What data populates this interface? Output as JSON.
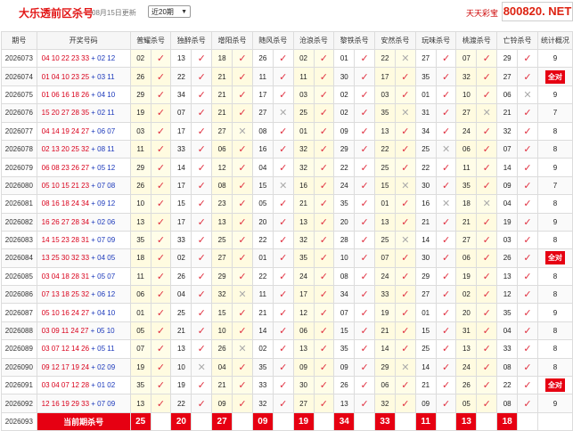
{
  "header": {
    "title": "大乐透前区杀号",
    "updated": "08月15日更新",
    "select_value": "近20期",
    "brand": "天天彩宝",
    "watermark": "800820. NET"
  },
  "columns": [
    "期号",
    "开奖号码",
    "普耀杀号",
    "独醉杀号",
    "增阳杀号",
    "随风杀号",
    "沧浪杀号",
    "黎铁杀号",
    "安然杀号",
    "玩味杀号",
    "桃渡杀号",
    "亡铃杀号",
    "统计概况"
  ],
  "rows": [
    {
      "p": "2026073",
      "f": "04 10 22 23 33",
      "b": "02 12",
      "v": [
        "02",
        "13",
        "18",
        "26",
        "02",
        "01",
        "22",
        "27",
        "07",
        "29"
      ],
      "m": [
        1,
        1,
        1,
        1,
        1,
        1,
        0,
        1,
        1,
        1
      ],
      "s": "9"
    },
    {
      "p": "2026074",
      "f": "01 04 10 23 25",
      "b": "03 11",
      "v": [
        "26",
        "22",
        "21",
        "11",
        "11",
        "30",
        "17",
        "35",
        "32",
        "27"
      ],
      "m": [
        1,
        1,
        1,
        1,
        1,
        1,
        1,
        1,
        1,
        1
      ],
      "s": "全对"
    },
    {
      "p": "2026075",
      "f": "01 06 16 18 26",
      "b": "04 10",
      "v": [
        "29",
        "34",
        "21",
        "17",
        "03",
        "02",
        "03",
        "01",
        "10",
        "06"
      ],
      "m": [
        1,
        1,
        1,
        1,
        1,
        1,
        1,
        1,
        1,
        0
      ],
      "s": "9"
    },
    {
      "p": "2026076",
      "f": "15 20 27 28 35",
      "b": "02 11",
      "v": [
        "19",
        "07",
        "21",
        "27",
        "25",
        "02",
        "35",
        "31",
        "27",
        "21"
      ],
      "m": [
        1,
        1,
        1,
        0,
        1,
        1,
        0,
        1,
        0,
        1
      ],
      "s": "7"
    },
    {
      "p": "2026077",
      "f": "04 14 19 24 27",
      "b": "06 07",
      "v": [
        "03",
        "17",
        "27",
        "08",
        "01",
        "09",
        "13",
        "34",
        "24",
        "32"
      ],
      "m": [
        1,
        1,
        0,
        1,
        1,
        1,
        1,
        1,
        1,
        1
      ],
      "s": "8"
    },
    {
      "p": "2026078",
      "f": "02 13 20 25 32",
      "b": "08 11",
      "v": [
        "11",
        "33",
        "06",
        "16",
        "32",
        "29",
        "22",
        "25",
        "06",
        "07"
      ],
      "m": [
        1,
        1,
        1,
        1,
        1,
        1,
        1,
        0,
        1,
        1
      ],
      "s": "8"
    },
    {
      "p": "2026079",
      "f": "06 08 23 26 27",
      "b": "05 12",
      "v": [
        "29",
        "14",
        "12",
        "04",
        "32",
        "22",
        "25",
        "22",
        "11",
        "14"
      ],
      "m": [
        1,
        1,
        1,
        1,
        1,
        1,
        1,
        1,
        1,
        1
      ],
      "s": "9"
    },
    {
      "p": "2026080",
      "f": "05 10 15 21 23",
      "b": "07 08",
      "v": [
        "26",
        "17",
        "08",
        "15",
        "16",
        "24",
        "15",
        "30",
        "35",
        "09"
      ],
      "m": [
        1,
        1,
        1,
        0,
        1,
        1,
        0,
        1,
        1,
        1
      ],
      "s": "7"
    },
    {
      "p": "2026081",
      "f": "08 16 18 24 34",
      "b": "09 12",
      "v": [
        "10",
        "15",
        "23",
        "05",
        "21",
        "35",
        "01",
        "16",
        "18",
        "04"
      ],
      "m": [
        1,
        1,
        1,
        1,
        1,
        1,
        1,
        0,
        0,
        1
      ],
      "s": "8"
    },
    {
      "p": "2026082",
      "f": "16 26 27 28 34",
      "b": "02 06",
      "v": [
        "13",
        "17",
        "13",
        "20",
        "13",
        "20",
        "13",
        "21",
        "21",
        "19"
      ],
      "m": [
        1,
        1,
        1,
        1,
        1,
        1,
        1,
        1,
        1,
        1
      ],
      "s": "9"
    },
    {
      "p": "2026083",
      "f": "14 15 23 28 31",
      "b": "07 09",
      "v": [
        "35",
        "33",
        "25",
        "22",
        "32",
        "28",
        "25",
        "14",
        "27",
        "03"
      ],
      "m": [
        1,
        1,
        1,
        1,
        1,
        1,
        0,
        1,
        1,
        1
      ],
      "s": "8"
    },
    {
      "p": "2026084",
      "f": "13 25 30 32 33",
      "b": "04 05",
      "v": [
        "18",
        "02",
        "27",
        "01",
        "35",
        "10",
        "07",
        "30",
        "06",
        "26"
      ],
      "m": [
        1,
        1,
        1,
        1,
        1,
        1,
        1,
        1,
        1,
        1
      ],
      "s": "全对"
    },
    {
      "p": "2026085",
      "f": "03 04 18 28 31",
      "b": "05 07",
      "v": [
        "11",
        "26",
        "29",
        "22",
        "24",
        "08",
        "24",
        "29",
        "19",
        "13"
      ],
      "m": [
        1,
        1,
        1,
        1,
        1,
        1,
        1,
        1,
        1,
        1
      ],
      "s": "8"
    },
    {
      "p": "2026086",
      "f": "07 13 18 25 32",
      "b": "06 12",
      "v": [
        "06",
        "04",
        "32",
        "11",
        "17",
        "34",
        "33",
        "27",
        "02",
        "12"
      ],
      "m": [
        1,
        1,
        0,
        1,
        1,
        1,
        1,
        1,
        1,
        1
      ],
      "s": "8"
    },
    {
      "p": "2026087",
      "f": "05 10 16 24 27",
      "b": "04 10",
      "v": [
        "01",
        "25",
        "15",
        "21",
        "12",
        "07",
        "19",
        "01",
        "20",
        "35"
      ],
      "m": [
        1,
        1,
        1,
        1,
        1,
        1,
        1,
        1,
        1,
        1
      ],
      "s": "9"
    },
    {
      "p": "2026088",
      "f": "03 09 11 24 27",
      "b": "05 10",
      "v": [
        "05",
        "21",
        "10",
        "14",
        "06",
        "15",
        "21",
        "15",
        "31",
        "04"
      ],
      "m": [
        1,
        1,
        1,
        1,
        1,
        1,
        1,
        1,
        1,
        1
      ],
      "s": "8"
    },
    {
      "p": "2026089",
      "f": "03 07 12 14 26",
      "b": "05 11",
      "v": [
        "07",
        "13",
        "26",
        "02",
        "13",
        "35",
        "14",
        "25",
        "13",
        "33"
      ],
      "m": [
        1,
        1,
        0,
        1,
        1,
        1,
        1,
        1,
        1,
        1
      ],
      "s": "8"
    },
    {
      "p": "2026090",
      "f": "09 12 17 19 24",
      "b": "02 09",
      "v": [
        "19",
        "10",
        "04",
        "35",
        "09",
        "09",
        "29",
        "14",
        "24",
        "08"
      ],
      "m": [
        1,
        0,
        1,
        1,
        1,
        1,
        0,
        1,
        1,
        1
      ],
      "s": "8"
    },
    {
      "p": "2026091",
      "f": "03 04 07 12 28",
      "b": "01 02",
      "v": [
        "35",
        "19",
        "21",
        "33",
        "30",
        "26",
        "06",
        "21",
        "26",
        "22"
      ],
      "m": [
        1,
        1,
        1,
        1,
        1,
        1,
        1,
        1,
        1,
        1
      ],
      "s": "全对"
    },
    {
      "p": "2026092",
      "f": "12 16 19 29 33",
      "b": "07 09",
      "v": [
        "13",
        "22",
        "09",
        "32",
        "27",
        "13",
        "32",
        "09",
        "05",
        "08"
      ],
      "m": [
        1,
        1,
        1,
        1,
        1,
        1,
        1,
        1,
        1,
        1
      ],
      "s": "9"
    }
  ],
  "current": {
    "p": "2026093",
    "label": "当前期杀号",
    "v": [
      "25",
      "20",
      "27",
      "09",
      "19",
      "34",
      "33",
      "11",
      "13",
      "18"
    ]
  }
}
